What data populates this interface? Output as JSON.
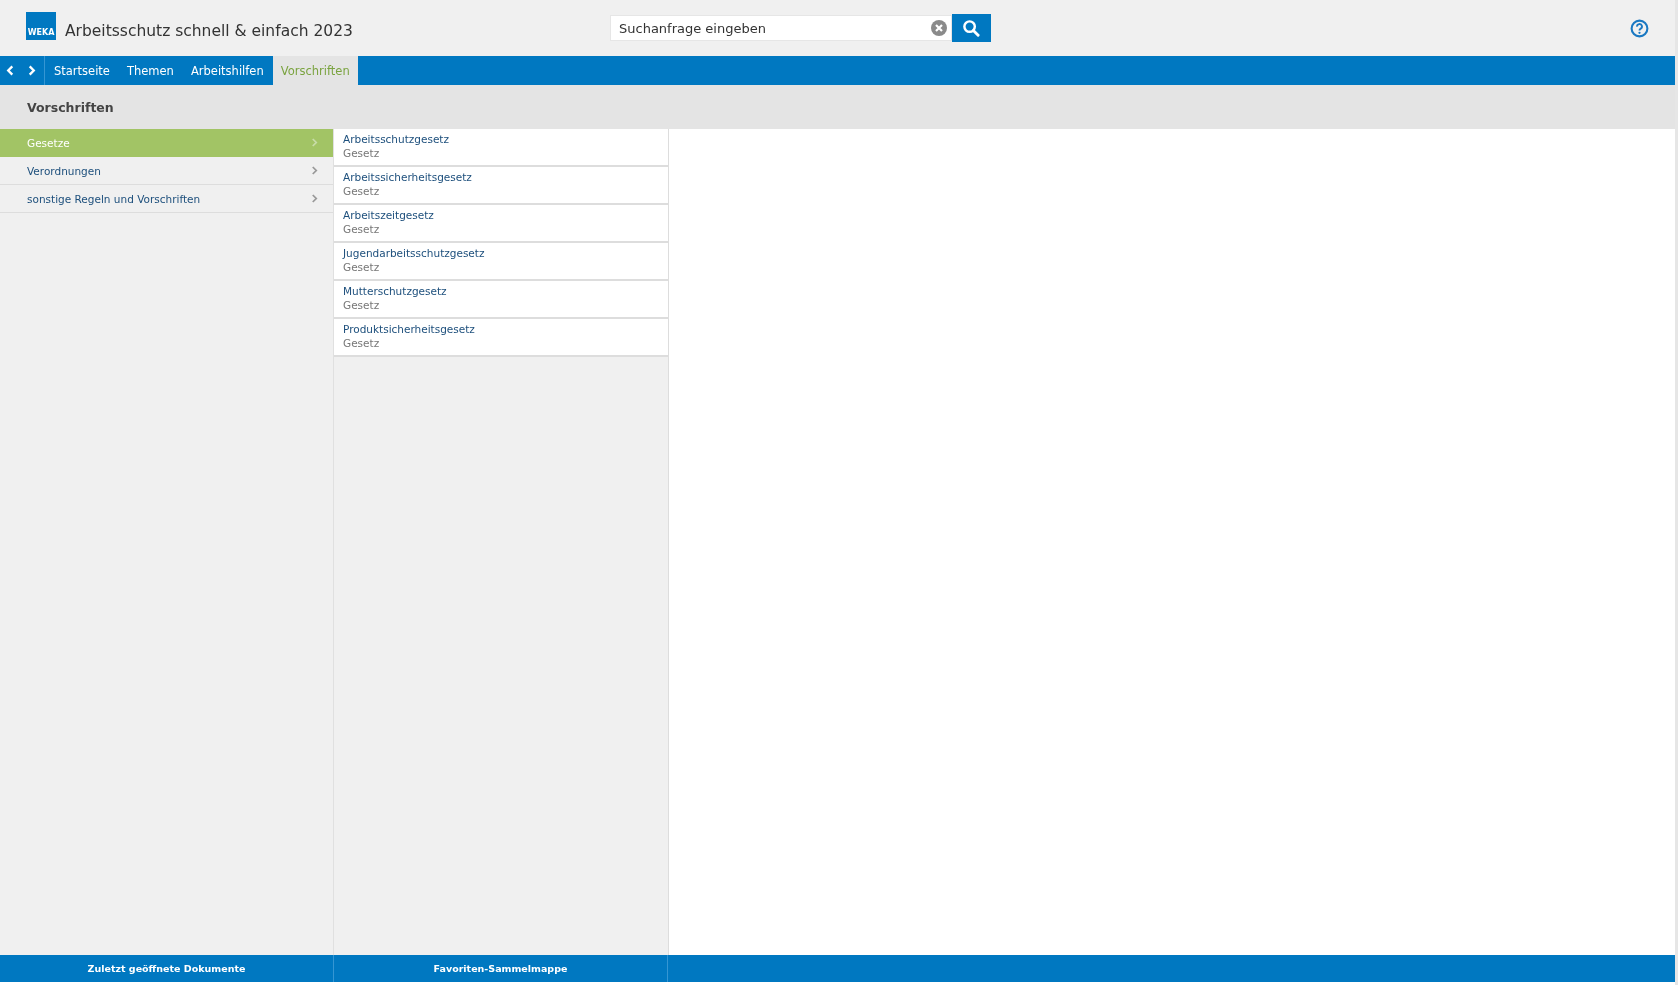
{
  "header": {
    "logo": "WEKA",
    "title": "Arbeitsschutz schnell & einfach 2023",
    "search": {
      "placeholder": "Suchanfrage eingeben"
    }
  },
  "nav": {
    "tabs": [
      {
        "label": "Startseite",
        "selected": false
      },
      {
        "label": "Themen",
        "selected": false
      },
      {
        "label": "Arbeitshilfen",
        "selected": false
      },
      {
        "label": "Vorschriften",
        "selected": true
      }
    ]
  },
  "section_title": "Vorschriften",
  "sidebar": {
    "items": [
      {
        "label": "Gesetze",
        "selected": true
      },
      {
        "label": "Verordnungen",
        "selected": false
      },
      {
        "label": "sonstige Regeln und Vorschriften",
        "selected": false
      }
    ]
  },
  "documents": [
    {
      "title": "Arbeitsschutzgesetz",
      "type": "Gesetz"
    },
    {
      "title": "Arbeitssicherheitsgesetz",
      "type": "Gesetz"
    },
    {
      "title": "Arbeitszeitgesetz",
      "type": "Gesetz"
    },
    {
      "title": "Jugendarbeitsschutzgesetz",
      "type": "Gesetz"
    },
    {
      "title": "Mutterschutzgesetz",
      "type": "Gesetz"
    },
    {
      "title": "Produktsicherheitsgesetz",
      "type": "Gesetz"
    }
  ],
  "footer": {
    "buttons": [
      "Zuletzt geöffnete Dokumente",
      "Favoriten-Sammelmappe"
    ]
  }
}
